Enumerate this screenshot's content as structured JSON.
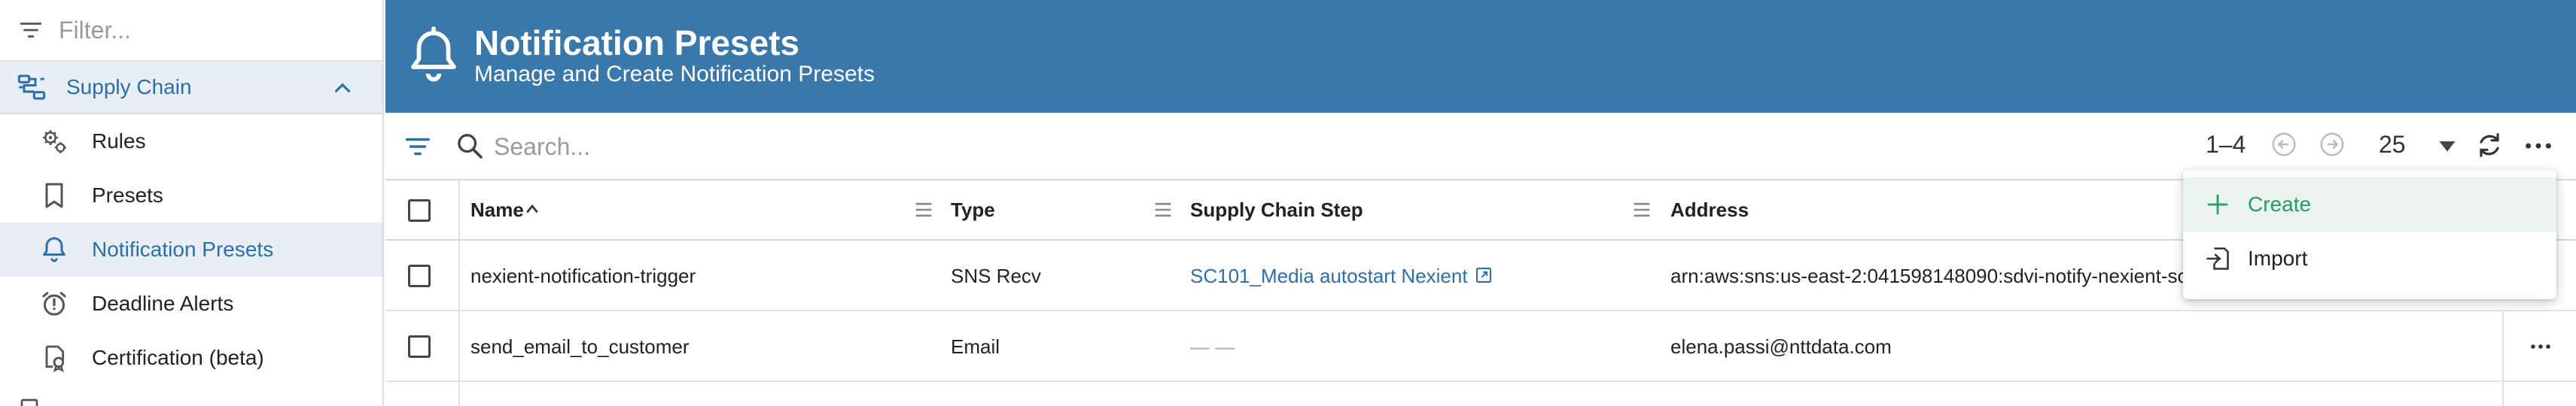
{
  "sidebar": {
    "filter_placeholder": "Filter...",
    "group": {
      "label": "Supply Chain",
      "icon": "workflow-icon",
      "expanded": true
    },
    "items": [
      {
        "label": "Rules",
        "icon": "gears-icon",
        "active": false
      },
      {
        "label": "Presets",
        "icon": "bookmark-icon",
        "active": false
      },
      {
        "label": "Notification Presets",
        "icon": "bell-icon",
        "active": true
      },
      {
        "label": "Deadline Alerts",
        "icon": "alarm-clock-icon",
        "active": false
      },
      {
        "label": "Certification (beta)",
        "icon": "certificate-icon",
        "active": false
      }
    ]
  },
  "header": {
    "title": "Notification Presets",
    "subtitle": "Manage and Create Notification Presets",
    "icon": "bell-icon",
    "background": "#3b78aa"
  },
  "toolbar": {
    "search_placeholder": "Search...",
    "range": "1–4",
    "page_size": "25"
  },
  "table": {
    "columns": [
      "Name",
      "Type",
      "Supply Chain Step",
      "Address"
    ],
    "sorted_column": "Name",
    "rows": [
      {
        "name": "nexient-notification-trigger",
        "type": "SNS Recv",
        "step": "SC101_Media autostart Nexient",
        "address": "arn:aws:sns:us-east-2:041598148090:sdvi-notify-nexient-so"
      },
      {
        "name": "send_email_to_customer",
        "type": "Email",
        "step": "— —",
        "address": "elena.passi@nttdata.com"
      }
    ]
  },
  "menu": {
    "items": [
      {
        "label": "Create",
        "icon": "plus-icon",
        "color": "#2a9a6a"
      },
      {
        "label": "Import",
        "icon": "import-icon"
      }
    ]
  },
  "colors": {
    "accent": "#2e6ea6",
    "active_bg": "#e7eef5",
    "create_green": "#2a9a6a"
  }
}
